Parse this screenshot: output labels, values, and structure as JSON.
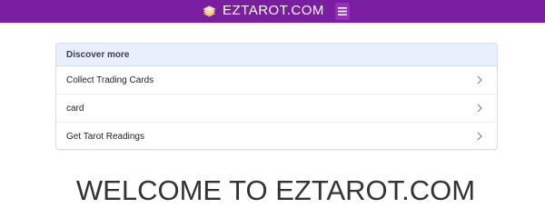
{
  "header": {
    "site_name": "EZTAROT.COM",
    "logo_icon": "stacked-cards-logo-icon",
    "menu_icon": "hamburger-icon",
    "menu_glyph": "☰",
    "colors": {
      "bar": "#7a1ea1",
      "menu_button": "#9c2bc4"
    }
  },
  "discover": {
    "title": "Discover more",
    "items": [
      {
        "label": "Collect Trading Cards"
      },
      {
        "label": "card"
      },
      {
        "label": "Get Tarot Readings"
      }
    ],
    "chevron_icon": "chevron-right-icon"
  },
  "main": {
    "heading": "WELCOME TO EZTAROT.COM"
  }
}
